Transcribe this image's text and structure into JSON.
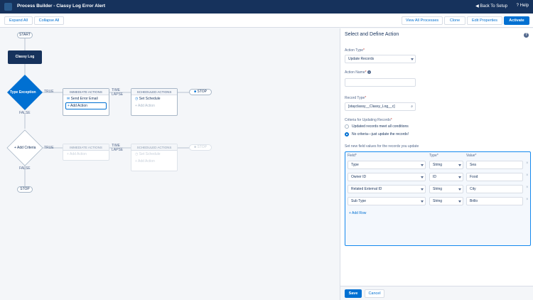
{
  "topbar": {
    "title": "Process Builder - Classy Log Error Alert",
    "back_label": "Back To Setup",
    "help_label": "Help"
  },
  "toolbar": {
    "expand_all": "Expand All",
    "collapse_all": "Collapse All",
    "view_all": "View All Processes",
    "clone": "Clone",
    "edit_properties": "Edit Properties",
    "activate": "Activate"
  },
  "canvas": {
    "start": "START",
    "object_node": "Classy Log",
    "criteria1": "Type Exception",
    "criteria2": "Add Criteria",
    "true_label": "TRUE",
    "false_label": "FALSE",
    "time_lapse": "TIME\nLAPSE",
    "stop": "STOP",
    "immediate_header": "IMMEDIATE ACTIONS",
    "scheduled_header": "SCHEDULED ACTIONS",
    "send_email": "Send Error Email",
    "add_action": "Add Action",
    "set_schedule": "Set Schedule"
  },
  "side": {
    "heading": "Select and Define Action",
    "action_type_label": "Action Type",
    "action_type_value": "Update Records",
    "action_name_label": "Action Name",
    "action_name_value": "",
    "record_type_label": "Record Type",
    "record_type_value": "[stayclassy__Classy_Log__c]",
    "criteria_label": "Criteria for Updating Records",
    "radio_all": "Updated records meet all conditions",
    "radio_none": "No criteria—just update the records!",
    "set_values_label": "Set new field values for the records you update",
    "col_field": "Field",
    "col_type": "Type",
    "col_value": "Value",
    "rows": [
      {
        "field": "Type",
        "type": "String",
        "value": "Sea"
      },
      {
        "field": "Owner ID",
        "type": "ID",
        "value": "Food"
      },
      {
        "field": "Related External ID",
        "type": "String",
        "value": "City"
      },
      {
        "field": "Sub Type",
        "type": "String",
        "value": "Brillo"
      }
    ],
    "add_row": "Add Row",
    "save": "Save",
    "cancel": "Cancel"
  },
  "colors": {
    "topbar": "#16325c",
    "brand": "#0070d2",
    "required": "#c23934"
  }
}
